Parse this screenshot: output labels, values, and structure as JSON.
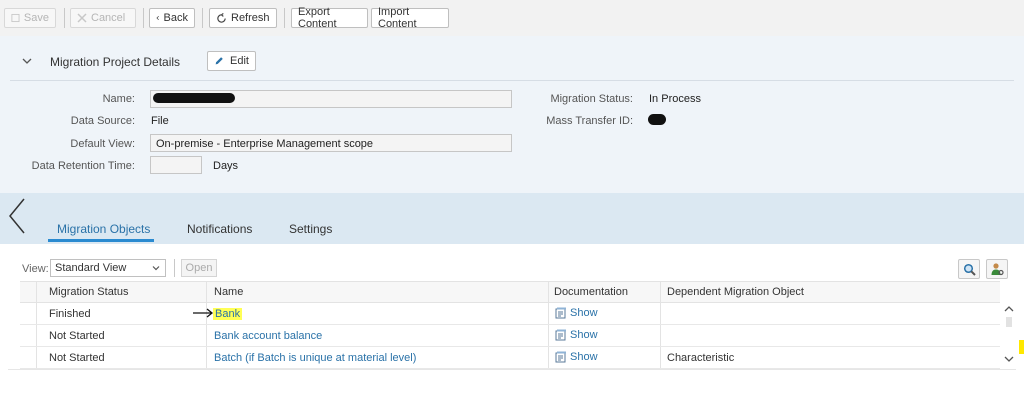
{
  "toolbar": {
    "save_label": "Save",
    "cancel_label": "Cancel",
    "back_label": "Back",
    "refresh_label": "Refresh",
    "export_label": "Export Content",
    "import_label": "Import Content"
  },
  "details": {
    "section_title": "Migration Project Details",
    "edit_label": "Edit",
    "fields": {
      "name_label": "Name:",
      "data_source_label": "Data Source:",
      "data_source_value": "File",
      "default_view_label": "Default View:",
      "default_view_value": "On-premise - Enterprise Management scope",
      "retention_label": "Data Retention Time:",
      "retention_unit": "Days",
      "status_label": "Migration Status:",
      "status_value": "In Process",
      "mass_transfer_label": "Mass Transfer ID:"
    }
  },
  "tabs": [
    {
      "label": "Migration Objects",
      "active": true
    },
    {
      "label": "Notifications",
      "active": false
    },
    {
      "label": "Settings",
      "active": false
    }
  ],
  "list": {
    "view_label": "View:",
    "view_value": "Standard View",
    "open_label": "Open",
    "columns": [
      "Migration Status",
      "Name",
      "Documentation",
      "Dependent Migration Object"
    ],
    "rows": [
      {
        "status": "Finished",
        "name": "Bank",
        "doc": "Show",
        "dependent": ""
      },
      {
        "status": "Not Started",
        "name": "Bank account balance",
        "doc": "Show",
        "dependent": ""
      },
      {
        "status": "Not Started",
        "name": "Batch (if Batch is unique at material level)",
        "doc": "Show",
        "dependent": "Characteristic"
      }
    ]
  },
  "colors": {
    "accent": "#2a72a8",
    "header_band": "#eff4f9",
    "tab_band": "#dbe8f2",
    "highlight": "#ffff55"
  }
}
